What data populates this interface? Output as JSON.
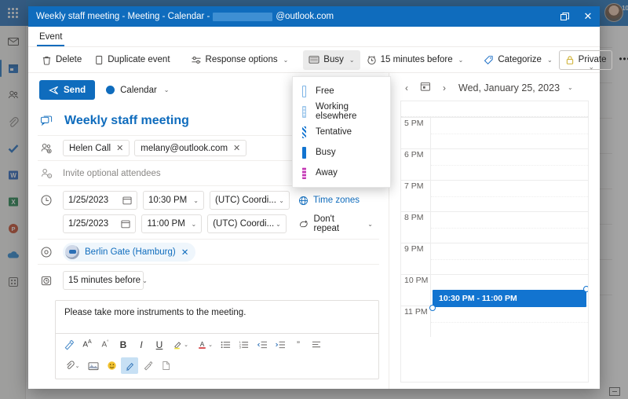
{
  "background": {
    "rail": [
      {
        "name": "app-launcher",
        "glyph": "waffle"
      },
      {
        "name": "mail",
        "glyph": "✉"
      },
      {
        "name": "calendar",
        "glyph": "▤"
      },
      {
        "name": "people",
        "glyph": "👥"
      },
      {
        "name": "files",
        "glyph": "🖇"
      },
      {
        "name": "todo",
        "glyph": "✔"
      },
      {
        "name": "word",
        "glyph": "W"
      },
      {
        "name": "excel",
        "glyph": "X"
      },
      {
        "name": "powerpoint",
        "glyph": "P"
      },
      {
        "name": "onedrive",
        "glyph": "☁"
      },
      {
        "name": "more-apps",
        "glyph": "⊞"
      }
    ],
    "notification_count": "10"
  },
  "titlebar": {
    "prefix": "Weekly staff meeting - Meeting - Calendar -",
    "suffix": "@outlook.com",
    "restore_glyph": "🗗",
    "close_glyph": "✕"
  },
  "tabs": [
    {
      "label": "Event",
      "selected": true
    }
  ],
  "ribbon": {
    "delete_label": "Delete",
    "duplicate_label": "Duplicate event",
    "response_label": "Response options",
    "busy_label": "Busy",
    "reminder_label": "15 minutes before",
    "categorize_label": "Categorize",
    "private_label": "Private",
    "overflow_label": "•••",
    "collapse_glyph": "⌄"
  },
  "busy_menu": {
    "open": true,
    "items": [
      {
        "label": "Free",
        "style": "sw-free"
      },
      {
        "label": "Working elsewhere",
        "style": "sw-elsewhere"
      },
      {
        "label": "Tentative",
        "style": "sw-tentative"
      },
      {
        "label": "Busy",
        "style": "sw-busy"
      },
      {
        "label": "Away",
        "style": "sw-away"
      }
    ]
  },
  "form": {
    "send_label": "Send",
    "calendar_label": "Calendar",
    "calendar_color": "#0f6cbd",
    "title": "Weekly staff meeting",
    "attendees": [
      {
        "label": "Helen Call"
      },
      {
        "label": "melany@outlook.com"
      }
    ],
    "optional_placeholder": "Invite optional attendees",
    "start_date": "1/25/2023",
    "start_time": "10:30 PM",
    "start_tz": "(UTC) Coordi...",
    "end_date": "1/25/2023",
    "end_time": "11:00 PM",
    "end_tz": "(UTC) Coordi...",
    "timezones_label": "Time zones",
    "repeat_label": "Don't repeat",
    "location": "Berlin Gate (Hamburg)",
    "reminder_value": "15 minutes before",
    "body_text": "Please take more instruments to the meeting.",
    "format_row1": [
      {
        "name": "format-painter-icon",
        "glyph": "🖌"
      },
      {
        "name": "font-grow-icon",
        "glyph": "Aᴀ"
      },
      {
        "name": "font-shrink-icon",
        "glyph": "A°"
      },
      {
        "name": "bold-icon",
        "glyph": "B"
      },
      {
        "name": "italic-icon",
        "glyph": "I"
      },
      {
        "name": "underline-icon",
        "glyph": "U"
      },
      {
        "name": "highlight-icon",
        "glyph": "🖊"
      },
      {
        "name": "font-color-icon",
        "glyph": "A"
      },
      {
        "name": "bullet-list-icon",
        "glyph": "≡"
      },
      {
        "name": "numbered-list-icon",
        "glyph": "⒈"
      },
      {
        "name": "decrease-indent-icon",
        "glyph": "⇤"
      },
      {
        "name": "increase-indent-icon",
        "glyph": "⇥"
      },
      {
        "name": "quote-icon",
        "glyph": "”"
      },
      {
        "name": "align-icon",
        "glyph": "☰"
      }
    ],
    "format_row2": [
      {
        "name": "attach-icon",
        "glyph": "🖇"
      },
      {
        "name": "insert-image-icon",
        "glyph": "🖼"
      },
      {
        "name": "emoji-icon",
        "glyph": "🙂"
      },
      {
        "name": "signature-icon",
        "glyph": "✎"
      },
      {
        "name": "draw-icon",
        "glyph": "🖊"
      },
      {
        "name": "insert-file-icon",
        "glyph": "🗎"
      }
    ]
  },
  "calendar": {
    "date_label": "Wed, January 25, 2023",
    "prev_glyph": "‹",
    "next_glyph": "›",
    "today_glyph": "▦",
    "chevron_glyph": "⌄",
    "hours": [
      "5 PM",
      "6 PM",
      "7 PM",
      "8 PM",
      "9 PM",
      "10 PM",
      "11 PM"
    ],
    "event": {
      "label": "10:30 PM - 11:00 PM",
      "color": "#1274d0",
      "start_hour_index": 5,
      "half_offset": true
    }
  }
}
